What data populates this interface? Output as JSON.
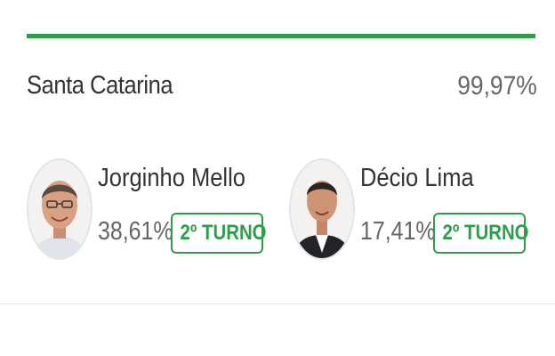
{
  "colors": {
    "accent_green": "#2e9e4a",
    "text_dark": "#333333",
    "text_muted": "#666666"
  },
  "state": {
    "name": "Santa Catarina",
    "counted_percent": "99,97%"
  },
  "candidates": [
    {
      "name": "Jorginho Mello",
      "percent": "38,61%",
      "status": "2º TURNO",
      "photo": "candidate-photo"
    },
    {
      "name": "Décio Lima",
      "percent": "17,41%",
      "status": "2º TURNO",
      "photo": "candidate-photo"
    }
  ]
}
